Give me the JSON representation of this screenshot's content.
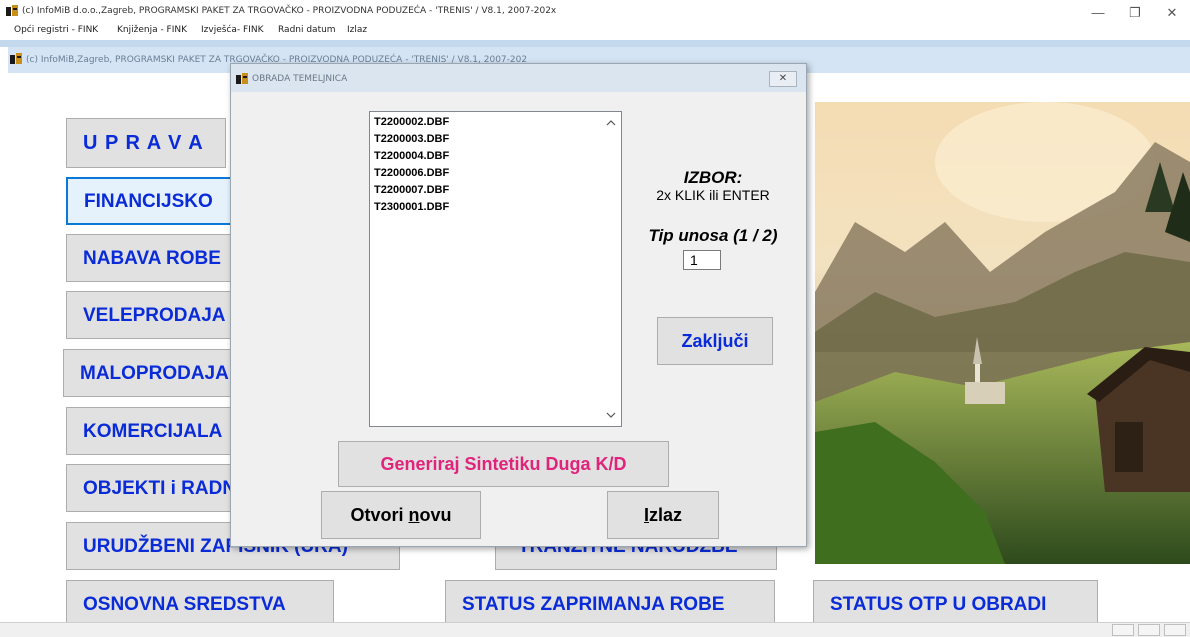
{
  "app": {
    "title": "(c) InfoMiB d.o.o.,Zagreb, PROGRAMSKI PAKET ZA TRGOVAČKO - PROIZVODNA PODUZEĆA - 'TRENIS' / V8.1, 2007-202x",
    "window_controls": {
      "minimize": "—",
      "restore": "❐",
      "close": "✕"
    }
  },
  "menubar": {
    "items": [
      "Opći registri - FINK",
      "Knjiženja - FINK",
      "Izvješća- FINK",
      "Radni datum",
      "Izlaz"
    ]
  },
  "child_window": {
    "title": "(c) InfoMiB,Zagreb, PROGRAMSKI PAKET ZA TRGOVAČKO - PROIZVODNA PODUZEĆA - 'TRENIS' / V8.1, 2007-202"
  },
  "main_menu": {
    "uprava": "U P R A V A",
    "financijsko": "FINANCIJSKO",
    "nabava": "NABAVA ROBE",
    "veleprodaja": "VELEPRODAJA",
    "maloprodaja": "MALOPRODAJA",
    "komercijala": "KOMERCIJALA",
    "objekti": "OBJEKTI i RADNICI",
    "urudzbeni": "URUDŽBENI ZAPISNIK (URA)",
    "tranzitne": "TRANZITNE NARUDŽBE",
    "osnovna": "OSNOVNA SREDSTVA",
    "status_zaprimanja": "STATUS ZAPRIMANJA ROBE",
    "status_otp": "STATUS OTP U OBRADI"
  },
  "dialog": {
    "title": "OBRADA TEMELJNICA",
    "close": "✕",
    "files": [
      "T2200002.DBF",
      "T2200003.DBF",
      "T2200004.DBF",
      "T2200006.DBF",
      "T2200007.DBF",
      "T2300001.DBF"
    ],
    "izbor_label": "IZBOR:",
    "izbor_hint": "2x KLIK ili ENTER",
    "tip_label": "Tip unosa (1 / 2)",
    "tip_value": "1",
    "zakljuci": "Zaključi",
    "generiraj": "Generiraj Sintetiku Duga K/D",
    "otvori_pre": "Otvori ",
    "otvori_u": "n",
    "otvori_post": "ovu",
    "izlaz_u": "I",
    "izlaz_post": "zlaz"
  },
  "colors": {
    "menu_text": "#0a2bd8",
    "accent_pink": "#e0237b",
    "active_border": "#0a78d7"
  }
}
